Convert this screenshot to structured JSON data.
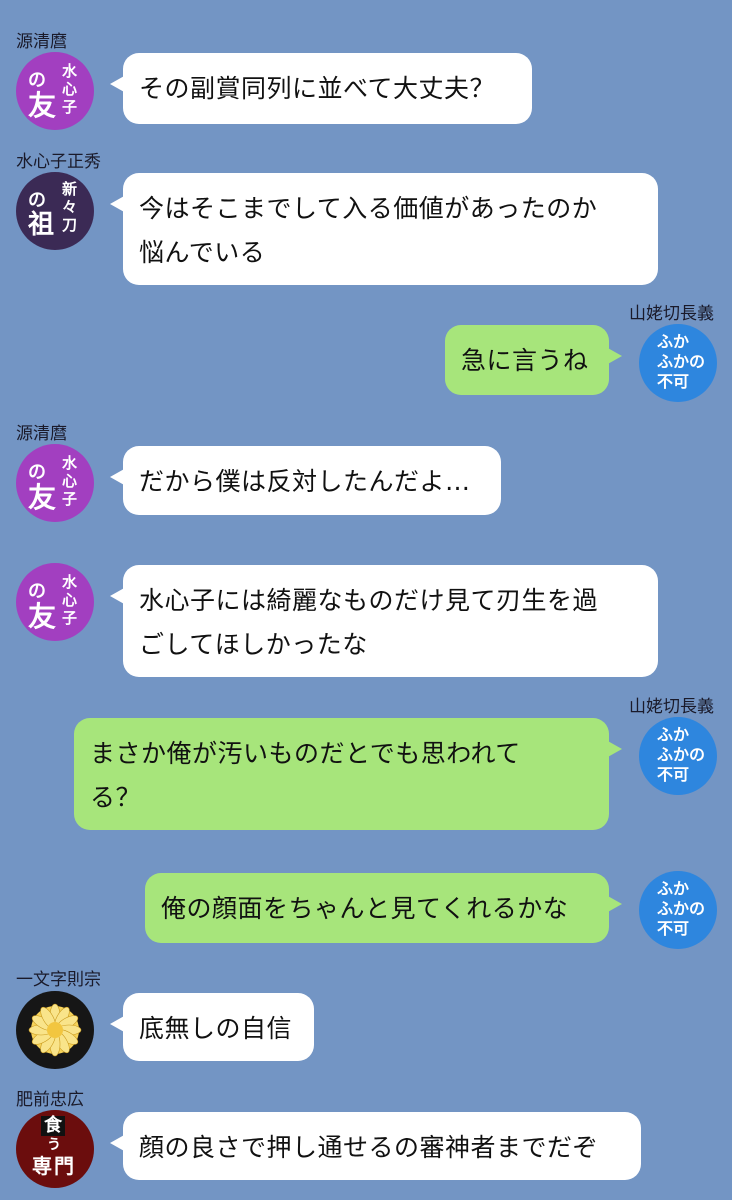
{
  "colors": {
    "background": "#7395c4",
    "bubble_incoming": "#ffffff",
    "bubble_outgoing": "#a7e57b",
    "avatar_purple": "#a23fc0",
    "avatar_navy": "#3b2a55",
    "avatar_blue": "#2e86de",
    "avatar_black": "#161616",
    "avatar_red": "#6b0d0d"
  },
  "messages": [
    {
      "sender": "源清麿",
      "text_lines": [
        "その副賞同列に並べて大丈夫？"
      ],
      "avatar": {
        "icon": "purple-badge-icon",
        "lines": [
          "水",
          "心",
          "子",
          "の",
          "友"
        ]
      }
    },
    {
      "sender": "水心子正秀",
      "text_lines": [
        "今はそこまでして入る価値があったのか",
        "悩んでいる"
      ],
      "avatar": {
        "icon": "navy-badge-icon",
        "lines": [
          "新",
          "々",
          "刀",
          "の",
          "祖"
        ]
      }
    },
    {
      "sender": "山姥切長義",
      "text_lines": [
        "急に言うね"
      ],
      "avatar": {
        "icon": "blue-badge-icon",
        "lines": [
          "ふか",
          "ふかの",
          "不可"
        ]
      }
    },
    {
      "sender": "源清麿",
      "text_lines": [
        "だから僕は反対したんだよ…"
      ],
      "avatar": {
        "icon": "purple-badge-icon",
        "lines": [
          "水",
          "心",
          "子",
          "の",
          "友"
        ]
      }
    },
    {
      "sender": "",
      "text_lines": [
        "水心子には綺麗なものだけ見て刃生を過",
        "ごしてほしかったな"
      ],
      "avatar": {
        "icon": "purple-badge-icon",
        "lines": [
          "水",
          "心",
          "子",
          "の",
          "友"
        ]
      }
    },
    {
      "sender": "山姥切長義",
      "text_lines": [
        "まさか俺が汚いものだとでも思われて",
        "る？"
      ],
      "avatar": {
        "icon": "blue-badge-icon",
        "lines": [
          "ふか",
          "ふかの",
          "不可"
        ]
      }
    },
    {
      "sender": "",
      "text_lines": [
        "俺の顔面をちゃんと見てくれるかな"
      ],
      "avatar": {
        "icon": "blue-badge-icon",
        "lines": [
          "ふか",
          "ふかの",
          "不可"
        ]
      }
    },
    {
      "sender": "一文字則宗",
      "text_lines": [
        "底無しの自信"
      ],
      "avatar": {
        "icon": "chrysanthemum-icon",
        "lines": []
      }
    },
    {
      "sender": "肥前忠広",
      "text_lines": [
        "顔の良さで押し通せるの審神者までだぞ"
      ],
      "avatar": {
        "icon": "red-badge-icon",
        "lines": [
          "食",
          "う",
          "専",
          "門"
        ]
      }
    }
  ]
}
